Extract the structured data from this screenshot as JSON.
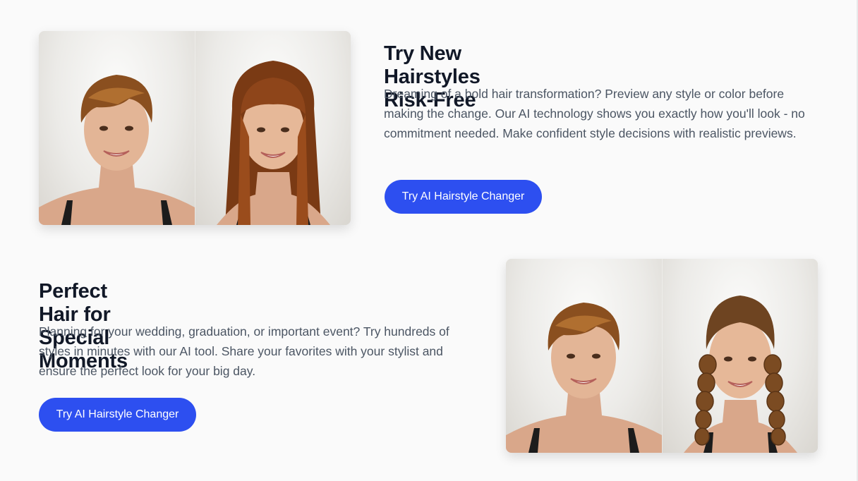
{
  "features": [
    {
      "title": "Try New Hairstyles Risk-Free",
      "description": "Dreaming of a bold hair transformation? Preview any style or color before making the change. Our AI technology shows you exactly how you'll look - no commitment needed. Make confident style decisions with realistic previews.",
      "button_label": "Try AI Hairstyle Changer",
      "before_image": "short-pixie-hair-portrait",
      "after_image": "long-straight-hair-with-bangs-portrait"
    },
    {
      "title": "Perfect Hair for Special Moments",
      "description": "Planning for your wedding, graduation, or important event? Try hundreds of styles in minutes with our AI tool. Share your favorites with your stylist and ensure the perfect look for your big day.",
      "button_label": "Try AI Hairstyle Changer",
      "before_image": "short-pixie-hair-portrait",
      "after_image": "braided-pigtails-portrait"
    }
  ],
  "colors": {
    "background": "#fafafa",
    "heading": "#111827",
    "body_text": "#4b5563",
    "button": "#2d4ff0",
    "button_text": "#ffffff"
  }
}
